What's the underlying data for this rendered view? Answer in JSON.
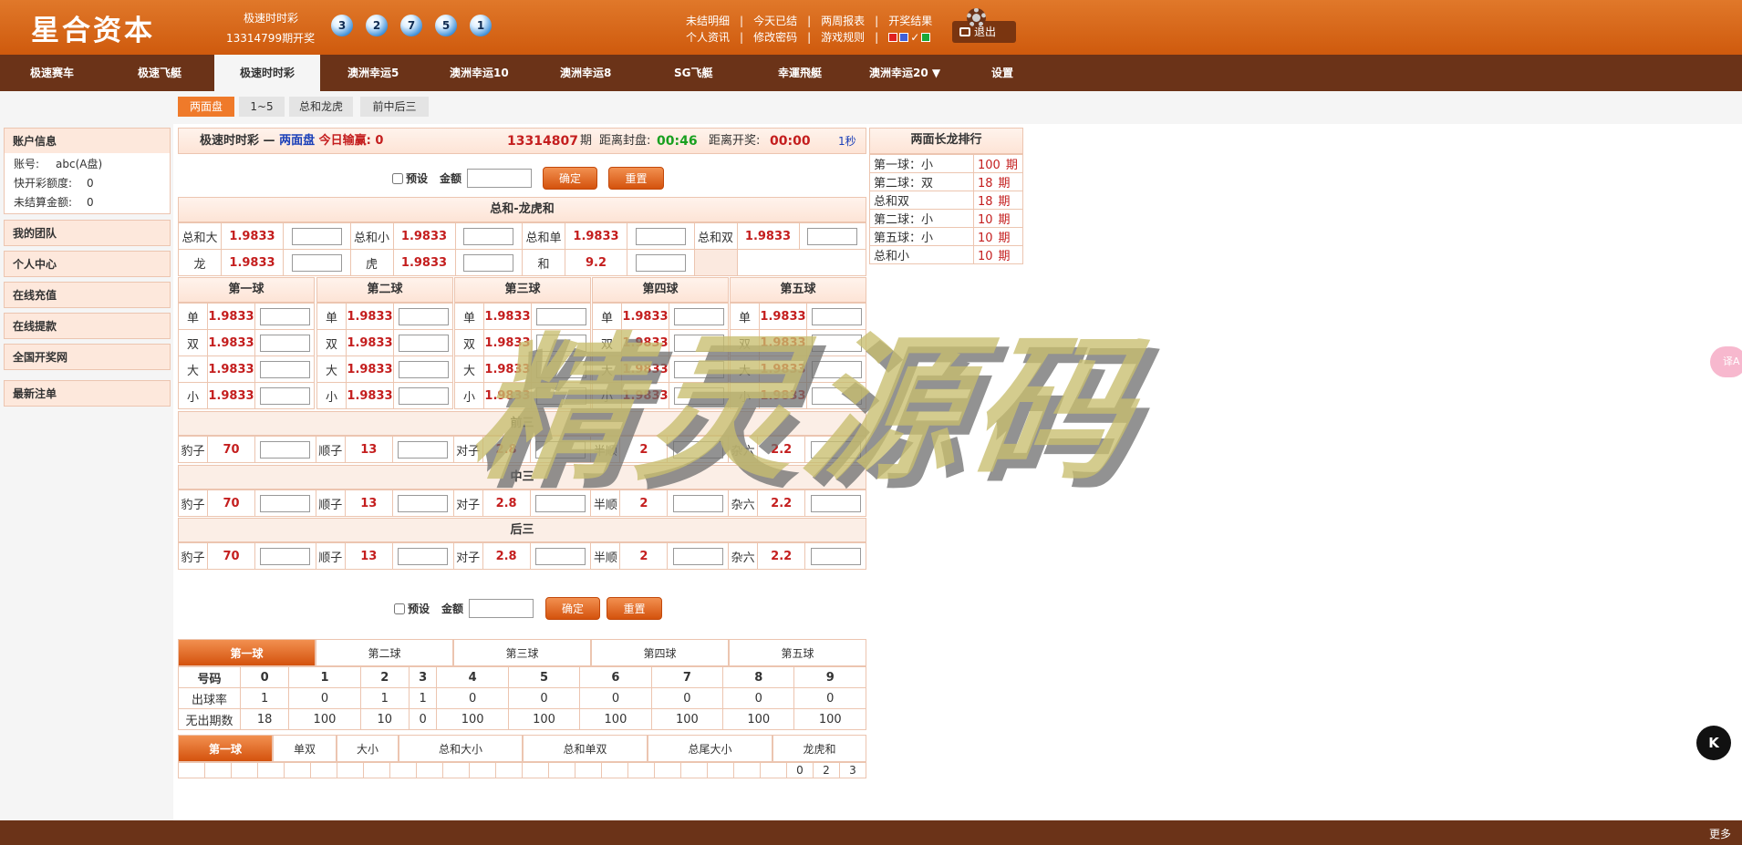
{
  "header": {
    "logo": "星合资本",
    "draw_title": "极速时时彩",
    "draw_next": "13314799期开奖",
    "balls": [
      "3",
      "2",
      "7",
      "5",
      "1"
    ],
    "links_row1": [
      "未结明细",
      "今天已结",
      "两周报表",
      "开奖结果"
    ],
    "links_row2": [
      "个人资讯",
      "修改密码",
      "游戏规则"
    ],
    "swatch_colors": [
      "#e02020",
      "#4060d8",
      "#1aa838"
    ],
    "logout": "退出"
  },
  "nav": {
    "items": [
      "极速赛车",
      "极速飞艇",
      "极速时时彩",
      "澳洲幸运5",
      "澳洲幸运10",
      "澳洲幸运8",
      "SG飞艇",
      "幸運飛艇",
      "澳洲幸运20 ▼"
    ],
    "settings": "设置"
  },
  "subnav": [
    "两面盘",
    "1~5",
    "总和龙虎",
    "前中后三"
  ],
  "sidebar": {
    "account_title": "账户信息",
    "acct_label": "账号:",
    "acct_value": "abc(A盘)",
    "quota_label": "快开彩额度:",
    "quota_value": "0",
    "unsettled_label": "未结算金额:",
    "unsettled_value": "0",
    "menu": [
      "我的团队",
      "个人中心",
      "在线充值",
      "在线提款",
      "全国开奖网",
      "最新注单"
    ]
  },
  "main": {
    "game": "极速时时彩",
    "dash": "—",
    "mode": "两面盘",
    "today_label": "今日输赢:",
    "today_value": "0",
    "period": "13314807",
    "period_suffix": "期",
    "close_label": "距离封盘:",
    "close_time": "00:46",
    "open_label": "距离开奖:",
    "open_time": "00:00",
    "refresh": "1秒",
    "preset": "预设",
    "amount": "金额",
    "confirm": "确定",
    "reset": "重置",
    "sum_title": "总和-龙虎和",
    "sum_rows": [
      [
        [
          "总和大",
          "1.9833"
        ],
        [
          "总和小",
          "1.9833"
        ],
        [
          "总和单",
          "1.9833"
        ],
        [
          "总和双",
          "1.9833"
        ]
      ],
      [
        [
          "龙",
          "1.9833"
        ],
        [
          "虎",
          "1.9833"
        ],
        [
          "和",
          "9.2"
        ]
      ]
    ],
    "balls": [
      {
        "title": "第一球",
        "rows": [
          [
            "单",
            "1.9833"
          ],
          [
            "双",
            "1.9833"
          ],
          [
            "大",
            "1.9833"
          ],
          [
            "小",
            "1.9833"
          ]
        ]
      },
      {
        "title": "第二球",
        "rows": [
          [
            "单",
            "1.9833"
          ],
          [
            "双",
            "1.9833"
          ],
          [
            "大",
            "1.9833"
          ],
          [
            "小",
            "1.9833"
          ]
        ]
      },
      {
        "title": "第三球",
        "rows": [
          [
            "单",
            "1.9833"
          ],
          [
            "双",
            "1.9833"
          ],
          [
            "大",
            "1.9833"
          ],
          [
            "小",
            "1.9833"
          ]
        ]
      },
      {
        "title": "第四球",
        "rows": [
          [
            "单",
            "1.9833"
          ],
          [
            "双",
            "1.9833"
          ],
          [
            "大",
            "1.9833"
          ],
          [
            "小",
            "1.9833"
          ]
        ]
      },
      {
        "title": "第五球",
        "rows": [
          [
            "单",
            "1.9833"
          ],
          [
            "双",
            "1.9833"
          ],
          [
            "大",
            "1.9833"
          ],
          [
            "小",
            "1.9833"
          ]
        ]
      }
    ],
    "sections": [
      {
        "title": "前三",
        "items": [
          [
            "豹子",
            "70"
          ],
          [
            "顺子",
            "13"
          ],
          [
            "对子",
            "2.8"
          ],
          [
            "半顺",
            "2"
          ],
          [
            "杂六",
            "2.2"
          ]
        ]
      },
      {
        "title": "中三",
        "items": [
          [
            "豹子",
            "70"
          ],
          [
            "顺子",
            "13"
          ],
          [
            "对子",
            "2.8"
          ],
          [
            "半顺",
            "2"
          ],
          [
            "杂六",
            "2.2"
          ]
        ]
      },
      {
        "title": "后三",
        "items": [
          [
            "豹子",
            "70"
          ],
          [
            "顺子",
            "13"
          ],
          [
            "对子",
            "2.8"
          ],
          [
            "半顺",
            "2"
          ],
          [
            "杂六",
            "2.2"
          ]
        ]
      }
    ],
    "stat_tabs": [
      "第一球",
      "第二球",
      "第三球",
      "第四球",
      "第五球"
    ],
    "stat": {
      "header": [
        "号码",
        "0",
        "1",
        "2",
        "3",
        "4",
        "5",
        "6",
        "7",
        "8",
        "9"
      ],
      "rate": [
        "出球率",
        "1",
        "0",
        "1",
        "1",
        "0",
        "0",
        "0",
        "0",
        "0",
        "0"
      ],
      "miss": [
        "无出期数",
        "18",
        "100",
        "10",
        "0",
        "100",
        "100",
        "100",
        "100",
        "100",
        "100"
      ]
    },
    "road_tabs": [
      "第一球",
      "单双",
      "大小",
      "总和大小",
      "总和单双",
      "总尾大小",
      "龙虎和"
    ],
    "road_tail": [
      "0",
      "2",
      "3"
    ]
  },
  "rank": {
    "title": "两面长龙排行",
    "rows": [
      [
        "第一球：小",
        "100",
        "期"
      ],
      [
        "第二球：双",
        "18",
        "期"
      ],
      [
        "总和双",
        "18",
        "期"
      ],
      [
        "第二球：小",
        "10",
        "期"
      ],
      [
        "第五球：小",
        "10",
        "期"
      ],
      [
        "总和小",
        "10",
        "期"
      ]
    ]
  },
  "footer": {
    "more": "更多"
  },
  "watermark": "精灵源码",
  "floater": "译A",
  "badge": "K"
}
